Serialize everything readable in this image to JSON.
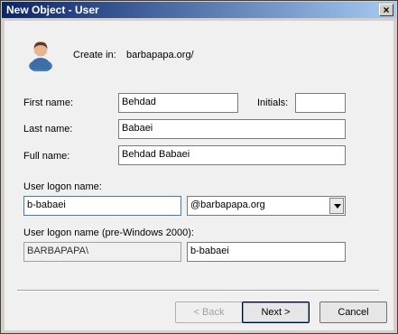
{
  "window": {
    "title": "New Object - User",
    "close_glyph": "×"
  },
  "header": {
    "icon": "user-icon",
    "create_in_label": "Create in:",
    "create_in_value": "barbapapa.org/"
  },
  "form": {
    "first_name_label": "First name:",
    "first_name_value": "Behdad",
    "initials_label": "Initials:",
    "initials_value": "",
    "last_name_label": "Last name:",
    "last_name_value": "Babaei",
    "full_name_label": "Full name:",
    "full_name_value": "Behdad Babaei",
    "logon_label": "User logon name:",
    "logon_value": "b-babaei",
    "domain_value": "@barbapapa.org",
    "pre2000_label": "User logon name (pre-Windows 2000):",
    "pre2000_domain": "BARBAPAPA\\",
    "pre2000_value": "b-babaei"
  },
  "buttons": {
    "back": "< Back",
    "next": "Next >",
    "cancel": "Cancel"
  }
}
